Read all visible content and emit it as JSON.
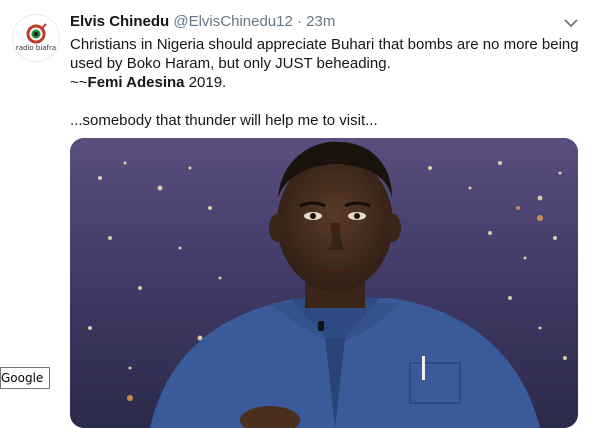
{
  "tweet": {
    "author_name": "Elvis Chinedu",
    "handle": "@ElvisChinedu12",
    "separator": "·",
    "timestamp": "23m",
    "avatar_text": "radio biafra",
    "line1": "Christians in Nigeria should appreciate Buhari that bombs are no more being",
    "line2": "used by Boko Haram,  but only JUST beheading.",
    "line3_prefix": "~~",
    "line3_bold": "Femi Adesina",
    "line3_suffix": " 2019.",
    "line4": "...somebody that thunder will help me to visit..."
  },
  "tooltip": {
    "label": "Google"
  },
  "colors": {
    "text": "#14171a",
    "secondary": "#657786",
    "shirt": "#3a5a9a",
    "background_night": "#3b3560"
  },
  "icons": {
    "caret": "chevron-down-icon"
  }
}
